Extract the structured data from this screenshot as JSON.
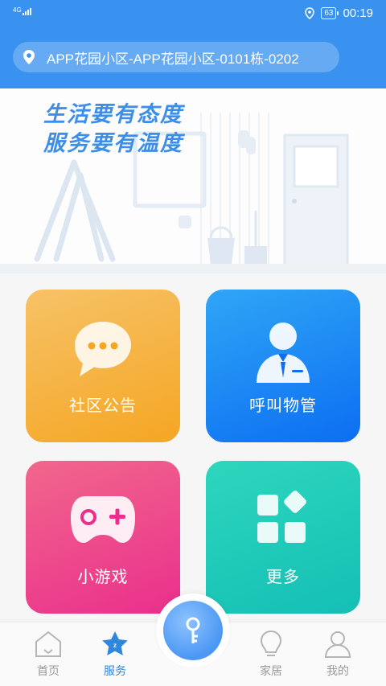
{
  "status_bar": {
    "network": "4G",
    "battery": "63",
    "time": "00:19"
  },
  "header": {
    "address": "APP花园小区-APP花园小区-0101栋-0202"
  },
  "banner": {
    "line1": "生活要有态度",
    "line2": "服务要有温度"
  },
  "cards": [
    {
      "label": "社区公告",
      "icon": "chat-bubble-icon"
    },
    {
      "label": "呼叫物管",
      "icon": "property-manager-icon"
    },
    {
      "label": "小游戏",
      "icon": "gamepad-icon"
    },
    {
      "label": "更多",
      "icon": "more-apps-icon"
    }
  ],
  "tabbar": {
    "home": "首页",
    "service": "服务",
    "house": "家居",
    "mine": "我的",
    "active": "service"
  },
  "colors": {
    "primary": "#3a92f0",
    "card1": "#f5a623",
    "card2": "#0c6ef2",
    "card3": "#ea2f8c",
    "card4": "#14bfb5"
  }
}
